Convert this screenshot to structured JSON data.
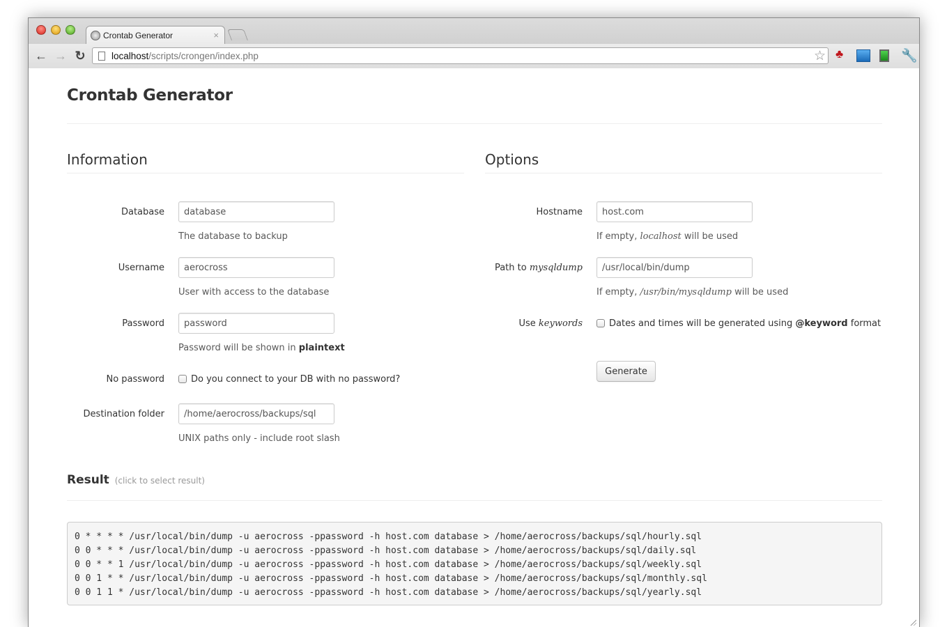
{
  "browser": {
    "tab_title": "Crontab Generator",
    "tab_close": "×",
    "url_host": "localhost",
    "url_path": "/scripts/crongen/index.php",
    "icons": [
      "back-icon",
      "forward-icon",
      "reload-icon",
      "page-icon",
      "bookmark-star-icon",
      "couch-extension-icon",
      "image-extension-icon",
      "monitor-extension-icon",
      "wrench-icon"
    ]
  },
  "page": {
    "title": "Crontab Generator",
    "information": {
      "heading": "Information",
      "database": {
        "label": "Database",
        "value": "database",
        "help": "The database to backup"
      },
      "username": {
        "label": "Username",
        "value": "aerocross",
        "help": "User with access to the database"
      },
      "password": {
        "label": "Password",
        "value": "password",
        "help_prefix": "Password will be shown in ",
        "help_bold": "plaintext"
      },
      "no_password": {
        "label": "No password",
        "checkbox_label": "Do you connect to your DB with no password?",
        "checked": false
      },
      "destination": {
        "label": "Destination folder",
        "value": "/home/aerocross/backups/sql",
        "help": "UNIX paths only - include root slash"
      }
    },
    "options": {
      "heading": "Options",
      "hostname": {
        "label": "Hostname",
        "value": "host.com",
        "help_prefix": "If empty, ",
        "help_italic": "localhost",
        "help_suffix": " will be used"
      },
      "mysqldump": {
        "label_prefix": "Path to ",
        "label_italic": "mysqldump",
        "value": "/usr/local/bin/dump",
        "help_prefix": "If empty, ",
        "help_italic": "/usr/bin/mysqldump",
        "help_suffix": " will be used"
      },
      "keywords": {
        "label_prefix": "Use ",
        "label_italic": "keywords",
        "checkbox_prefix": "Dates and times will be generated using ",
        "checkbox_bold": "@keyword",
        "checkbox_suffix": " format",
        "checked": false
      },
      "generate_label": "Generate"
    },
    "result": {
      "heading": "Result",
      "hint": "(click to select result)",
      "lines": [
        "0 * * * * /usr/local/bin/dump -u aerocross -ppassword -h host.com database > /home/aerocross/backups/sql/hourly.sql",
        "0 0 * * * /usr/local/bin/dump -u aerocross -ppassword -h host.com database > /home/aerocross/backups/sql/daily.sql",
        "0 0 * * 1 /usr/local/bin/dump -u aerocross -ppassword -h host.com database > /home/aerocross/backups/sql/weekly.sql",
        "0 0 1 * * /usr/local/bin/dump -u aerocross -ppassword -h host.com database > /home/aerocross/backups/sql/monthly.sql",
        "0 0 1 1 * /usr/local/bin/dump -u aerocross -ppassword -h host.com database > /home/aerocross/backups/sql/yearly.sql"
      ]
    }
  }
}
